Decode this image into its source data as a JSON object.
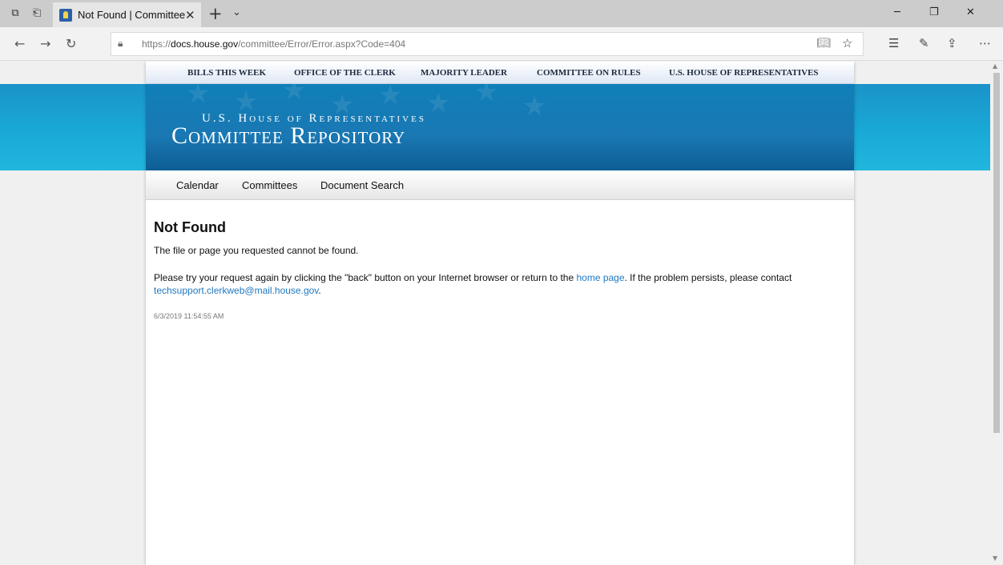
{
  "browser": {
    "tab_title": "Not Found | Committee",
    "tab_close_glyph": "✕",
    "new_tab_glyph": "+",
    "tab_drop_glyph": "⌄",
    "url_scheme": "https://",
    "url_domain": "docs.house.gov",
    "url_path": "/committee/Error/Error.aspx?Code=404",
    "icons": {
      "tab_aside": "tabs-aside-icon",
      "tab_restore": "restore-tabs-icon",
      "back": "back-arrow-icon",
      "forward": "forward-arrow-icon",
      "refresh": "refresh-icon",
      "lock": "lock-icon",
      "reading_view": "reading-view-icon",
      "favorite": "star-icon",
      "favorites_list": "favorites-list-icon",
      "pen": "pen-icon",
      "share": "share-icon",
      "more": "more-icon",
      "minimize": "minimize-icon",
      "maximize": "maximize-icon",
      "close": "close-icon"
    }
  },
  "site": {
    "top_nav": [
      "BILLS THIS WEEK",
      "OFFICE OF THE CLERK",
      "MAJORITY LEADER",
      "COMMITTEE ON RULES",
      "U.S. HOUSE OF REPRESENTATIVES"
    ],
    "banner": {
      "line1": "U.S. House of Representatives",
      "line2": "Committee Repository"
    },
    "sub_nav": [
      "Calendar",
      "Committees",
      "Document Search"
    ]
  },
  "error": {
    "heading": "Not Found",
    "message": "The file or page you requested cannot be found.",
    "help_prefix": "Please try your request again by clicking the \"back\" button on your Internet browser or return to the ",
    "home_link": "home page",
    "help_middle": ". If the problem persists, please contact ",
    "email_link": "techsupport.clerkweb@mail.house.gov",
    "help_suffix": ".",
    "timestamp": "6/3/2019 11:54:55 AM"
  },
  "colors": {
    "link": "#1f78c1",
    "banner": "#1a78b3",
    "band": "#19a9d7"
  }
}
